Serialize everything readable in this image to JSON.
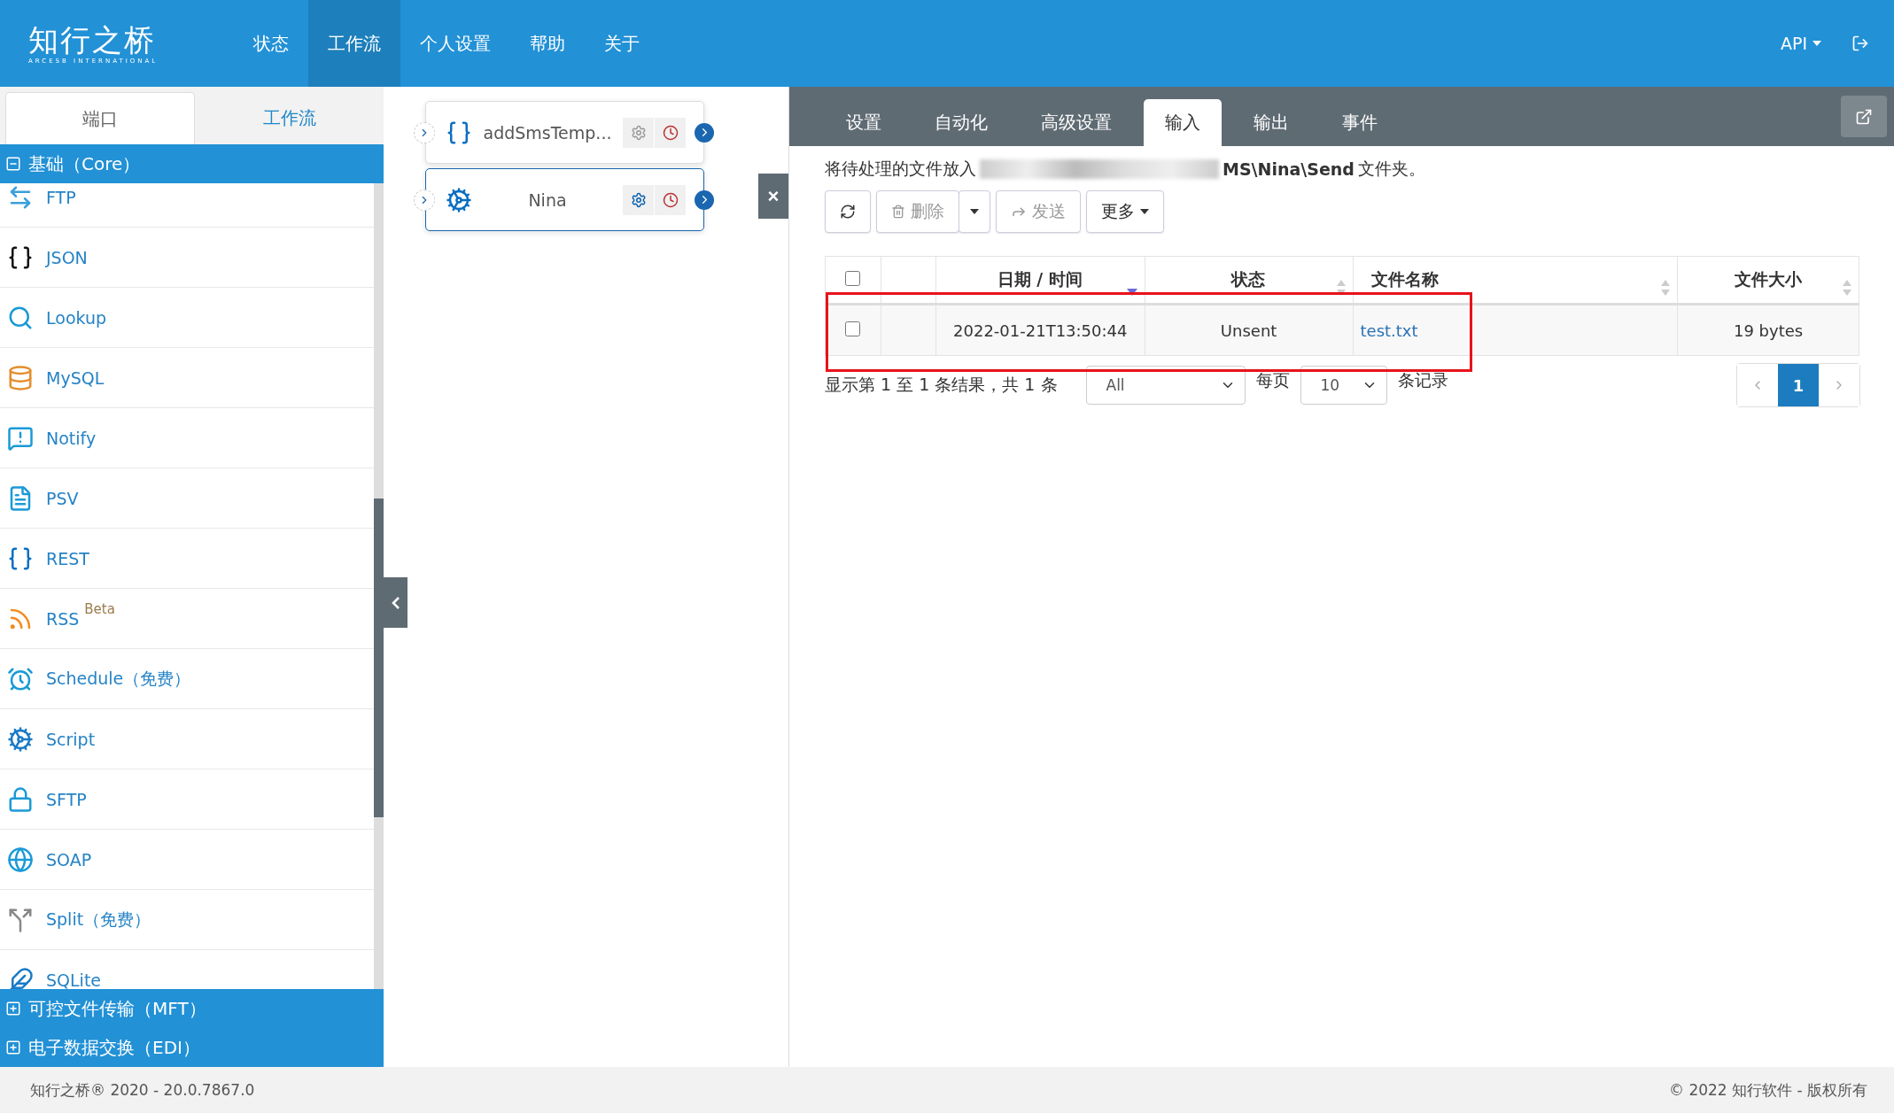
{
  "header": {
    "logo": {
      "name": "知行之桥",
      "tagline": "ARCESB INTERNATIONAL"
    },
    "nav": [
      {
        "label": "状态",
        "selected": false
      },
      {
        "label": "工作流",
        "selected": true
      },
      {
        "label": "个人设置",
        "selected": false
      },
      {
        "label": "帮助",
        "selected": false
      },
      {
        "label": "关于",
        "selected": false
      }
    ],
    "api_menu": "API"
  },
  "sidebar": {
    "tabs": [
      {
        "label": "端口",
        "selected": true
      },
      {
        "label": "工作流",
        "selected": false
      }
    ],
    "groups": [
      {
        "label": "基础（Core）",
        "expanded": true,
        "items": [
          {
            "label": "FTP"
          },
          {
            "label": "JSON"
          },
          {
            "label": "Lookup"
          },
          {
            "label": "MySQL"
          },
          {
            "label": "Notify"
          },
          {
            "label": "PSV"
          },
          {
            "label": "REST"
          },
          {
            "label": "RSS",
            "badge": "Beta"
          },
          {
            "label": "Schedule（免费）"
          },
          {
            "label": "Script"
          },
          {
            "label": "SFTP"
          },
          {
            "label": "SOAP"
          },
          {
            "label": "Split（免费）"
          },
          {
            "label": "SQLite"
          }
        ]
      },
      {
        "label": "可控文件传输（MFT）",
        "expanded": false
      },
      {
        "label": "电子数据交换（EDI）",
        "expanded": false
      }
    ]
  },
  "flow": {
    "nodes": [
      {
        "name": "addSmsTemp...",
        "kind": "rest",
        "selected": false
      },
      {
        "name": "Nina",
        "kind": "script",
        "selected": true
      }
    ],
    "close": "×"
  },
  "panel": {
    "tabs": [
      {
        "label": "设置",
        "selected": false
      },
      {
        "label": "自动化",
        "selected": false
      },
      {
        "label": "高级设置",
        "selected": false
      },
      {
        "label": "输入",
        "selected": true
      },
      {
        "label": "输出",
        "selected": false
      },
      {
        "label": "事件",
        "selected": false
      }
    ],
    "info": {
      "before": "将待处理的文件放入",
      "path_end": "MS\\Nina\\Send",
      "after": "文件夹。"
    },
    "toolbar": [
      {
        "kind": "refresh",
        "disabled": false
      },
      {
        "kind": "delete",
        "label": "删除",
        "disabled": true
      },
      {
        "kind": "send",
        "label": "发送",
        "disabled": true
      },
      {
        "kind": "more",
        "label": "更多",
        "disabled": false
      }
    ],
    "table": {
      "columns": [
        {
          "kind": "check",
          "checked": false
        },
        {
          "kind": "blank"
        },
        {
          "label": "日期 / 时间",
          "sorted": true
        },
        {
          "label": "状态",
          "sorted": false
        },
        {
          "label": "文件名称",
          "sorted": false
        },
        {
          "label": "文件大小",
          "sorted": false
        }
      ],
      "rows": [
        {
          "checked": false,
          "datetime": "2022-01-21T13:50:44",
          "status": "Unsent",
          "filename": "test.txt",
          "size": "19 bytes"
        }
      ]
    },
    "summary": "显示第 1 至 1 条结果，共 1 条",
    "filter": "All",
    "per_page_label": "每页",
    "per_page": "10",
    "records_label": "条记录",
    "pages": [
      {
        "label": "1",
        "selected": true
      }
    ]
  },
  "footer": {
    "left": "知行之桥® 2020 - 20.0.7867.0",
    "right": "© 2022 知行软件 - 版权所有"
  }
}
